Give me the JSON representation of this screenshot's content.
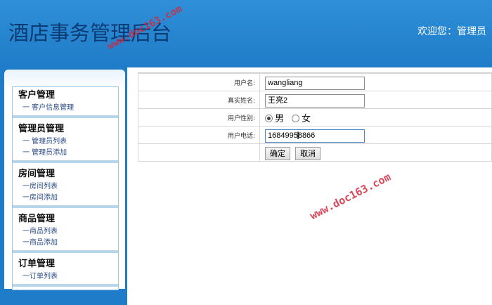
{
  "header": {
    "title": "酒店事务管理后台",
    "welcome": "欢迎您：管理员"
  },
  "sidebar": {
    "groups": [
      {
        "title": "客户管理",
        "items": [
          "一 客户信息管理"
        ]
      },
      {
        "title": "管理员管理",
        "items": [
          "一 管理员列表",
          "一 管理员添加"
        ]
      },
      {
        "title": "房间管理",
        "items": [
          "一房间列表",
          "一房间添加"
        ]
      },
      {
        "title": "商品管理",
        "items": [
          "一商品列表",
          "一商品添加"
        ]
      },
      {
        "title": "订单管理",
        "items": [
          "一订单列表"
        ]
      }
    ]
  },
  "form": {
    "username_label": "用户名:",
    "username_value": "wangliang",
    "realname_label": "真实姓名:",
    "realname_value": "王亮2",
    "gender_label": "用户性别:",
    "gender_options": [
      "男",
      "女"
    ],
    "gender_selected": "男",
    "phone_label": "用户电话:",
    "phone_value": "16849958866",
    "confirm_label": "确定",
    "cancel_label": "取消"
  },
  "watermark": {
    "text": "www.doc163.com",
    "color": "#d2283c"
  }
}
